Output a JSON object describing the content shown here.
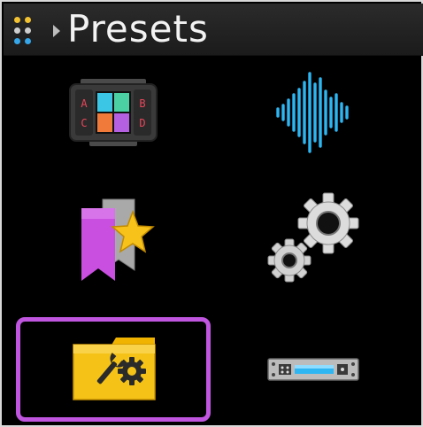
{
  "header": {
    "title": "Presets",
    "menu_icon": "grid-dots-icon",
    "breadcrumb_icon": "chevron-right-icon"
  },
  "colors": {
    "selection": "#c056e0",
    "waveform": "#2eb6f2",
    "folder": "#f5c318",
    "bookmark": "#c84fe0",
    "star": "#f7c21a"
  },
  "icons": [
    {
      "name": "mixer-pads-icon",
      "letters": [
        "A",
        "B",
        "C",
        "D"
      ]
    },
    {
      "name": "waveform-icon"
    },
    {
      "name": "bookmark-star-icon"
    },
    {
      "name": "gears-icon"
    },
    {
      "name": "folder-tools-icon",
      "selected": true
    },
    {
      "name": "rack-device-icon"
    }
  ]
}
